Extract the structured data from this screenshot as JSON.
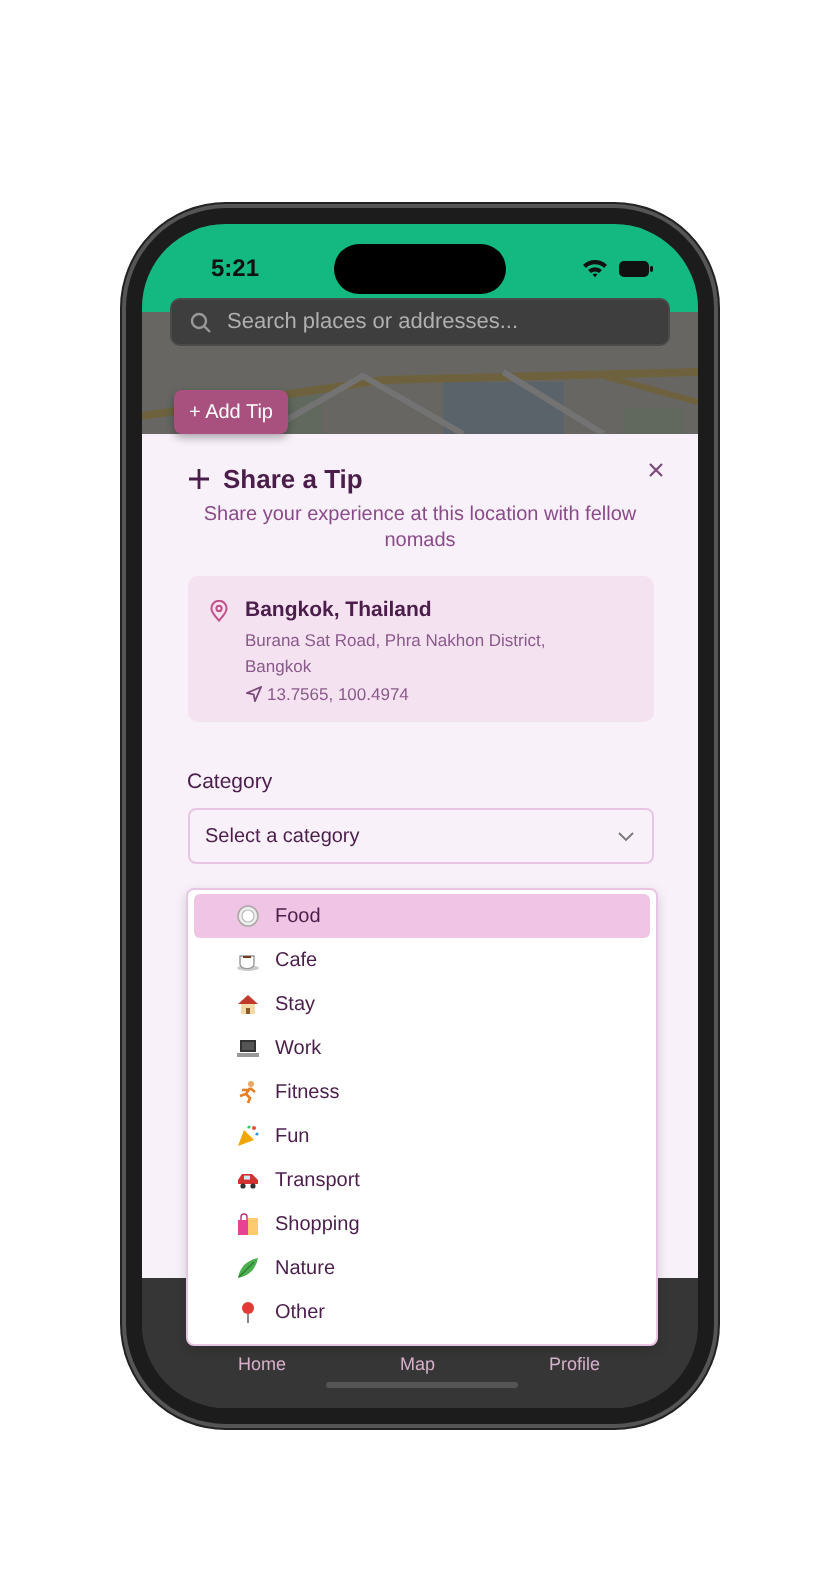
{
  "status_bar": {
    "time": "5:21"
  },
  "map": {
    "search": {
      "placeholder": "Search places or addresses..."
    },
    "add_tip_button": "+ Add Tip"
  },
  "sheet": {
    "title": "Share a Tip",
    "subtitle": "Share your experience at this location with fellow nomads",
    "location": {
      "name": "Bangkok, Thailand",
      "address": "Burana Sat Road, Phra Nakhon District, Bangkok",
      "coordinates": "13.7565, 100.4974"
    },
    "category": {
      "label": "Category",
      "placeholder": "Select a category"
    }
  },
  "category_menu": {
    "items": [
      {
        "label": "Food",
        "kind": "food",
        "selected": true
      },
      {
        "label": "Cafe",
        "kind": "cafe",
        "selected": false
      },
      {
        "label": "Stay",
        "kind": "stay",
        "selected": false
      },
      {
        "label": "Work",
        "kind": "work",
        "selected": false
      },
      {
        "label": "Fitness",
        "kind": "fitness",
        "selected": false
      },
      {
        "label": "Fun",
        "kind": "fun",
        "selected": false
      },
      {
        "label": "Transport",
        "kind": "transport",
        "selected": false
      },
      {
        "label": "Shopping",
        "kind": "shopping",
        "selected": false
      },
      {
        "label": "Nature",
        "kind": "nature",
        "selected": false
      },
      {
        "label": "Other",
        "kind": "other",
        "selected": false
      }
    ]
  },
  "bottom_nav": [
    {
      "label": "Home"
    },
    {
      "label": "Map"
    },
    {
      "label": "Profile"
    }
  ]
}
